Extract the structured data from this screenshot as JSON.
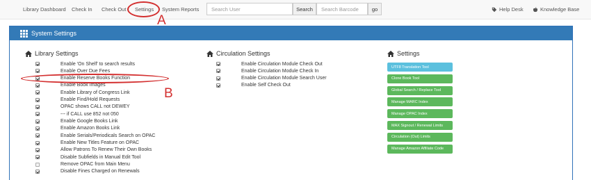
{
  "navbar": {
    "links": [
      "Library Dashboard",
      "Check In",
      "Check Out",
      "Settings",
      "System Reports"
    ],
    "search_user_placeholder": "Search User",
    "search_button": "Search",
    "search_barcode_placeholder": "Search Barcode",
    "go_button": "go",
    "help_desk": "Help Desk",
    "knowledge_base": "Knowledge Base"
  },
  "annotations": {
    "a": "A",
    "b": "B"
  },
  "panel": {
    "title": "System Settings"
  },
  "library_settings": {
    "title": "Library Settings",
    "items": [
      {
        "label": "Enable 'On Shelf' to search results",
        "checked": true
      },
      {
        "label": "Enable Over Due Fees",
        "checked": true
      },
      {
        "label": "Enable Reserve Books Function",
        "checked": true
      },
      {
        "label": "Enable Book Images",
        "checked": true
      },
      {
        "label": "Enable Library of Congress Link",
        "checked": true
      },
      {
        "label": "Enable Find/Hold Requests",
        "checked": true
      },
      {
        "label": "OPAC shows CALL not DEWEY",
        "checked": true
      },
      {
        "label": "--- if CALL use 852 not 050",
        "checked": true
      },
      {
        "label": "Enable Google Books Link",
        "checked": true
      },
      {
        "label": "Enable Amazon Books Link",
        "checked": true
      },
      {
        "label": "Enable Serials/Periodicals Search on OPAC",
        "checked": true
      },
      {
        "label": "Enable New Titles Feature on OPAC",
        "checked": true
      },
      {
        "label": "Allow Patrons To Renew Their Own Books",
        "checked": true
      },
      {
        "label": "Disable Subfields in Manual Edit Tool",
        "checked": true
      },
      {
        "label": "Remove OPAC from Main Menu",
        "checked": false
      },
      {
        "label": "Disable Fines Charged on Renewals",
        "checked": true
      }
    ]
  },
  "circulation_settings": {
    "title": "Circulation Settings",
    "items": [
      {
        "label": "Enable Circulation Module Check Out",
        "checked": true
      },
      {
        "label": "Enable Circulation Module Check In",
        "checked": true
      },
      {
        "label": "Enable Circulation Module Search User",
        "checked": true
      },
      {
        "label": "Enable Self Check Out",
        "checked": true
      }
    ]
  },
  "settings": {
    "title": "Settings",
    "buttons": [
      {
        "label": "UTF8 Translation Tool",
        "style": "info"
      },
      {
        "label": "Clone Book Tool",
        "style": "success"
      },
      {
        "label": "Global Search / Replace Tool",
        "style": "success"
      },
      {
        "label": "Manage MARC Index",
        "style": "success"
      },
      {
        "label": "Manage OPAC Index",
        "style": "success"
      },
      {
        "label": "MAX Signout / Renewal Limits",
        "style": "success"
      },
      {
        "label": "Circulation (Out) Limits",
        "style": "success"
      },
      {
        "label": "Manage Amazon Affiliate Code",
        "style": "success"
      }
    ]
  },
  "colors": {
    "primary": "#337ab7",
    "info": "#5bc0de",
    "success": "#5cb85c",
    "annotation": "#d32f2f"
  }
}
